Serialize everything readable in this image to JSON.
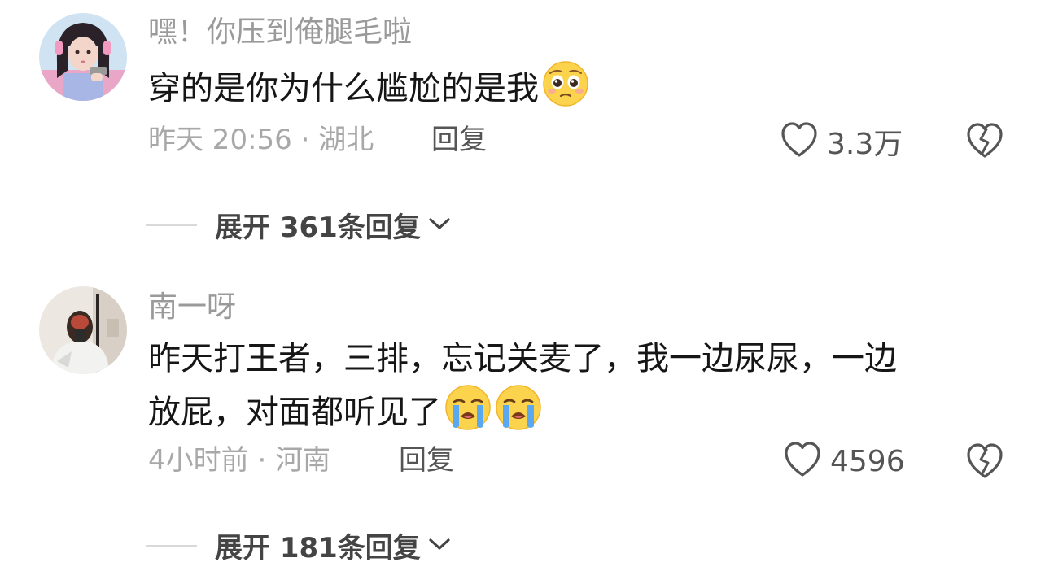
{
  "comments": [
    {
      "username": "嘿！你压到俺腿毛啦",
      "content": "穿的是你为什么尴尬的是我",
      "emoji": "pleading-face-emoji",
      "time_location": "昨天 20:56 · 湖北",
      "reply_label": "回复",
      "likes": "3.3万",
      "expand_label": "展开 361条回复"
    },
    {
      "username": "南一呀",
      "content_line1": "昨天打王者，三排，忘记关麦了，我一边尿尿，一边",
      "content_line2": "放屁，对面都听见了",
      "emoji": "loudly-crying-face-emoji",
      "time_location": "4小时前 · 河南",
      "reply_label": "回复",
      "likes": "4596",
      "expand_label": "展开 181条回复"
    }
  ],
  "colors": {
    "text": "#161616",
    "muted": "#9a9a9a",
    "icon": "#555555"
  }
}
